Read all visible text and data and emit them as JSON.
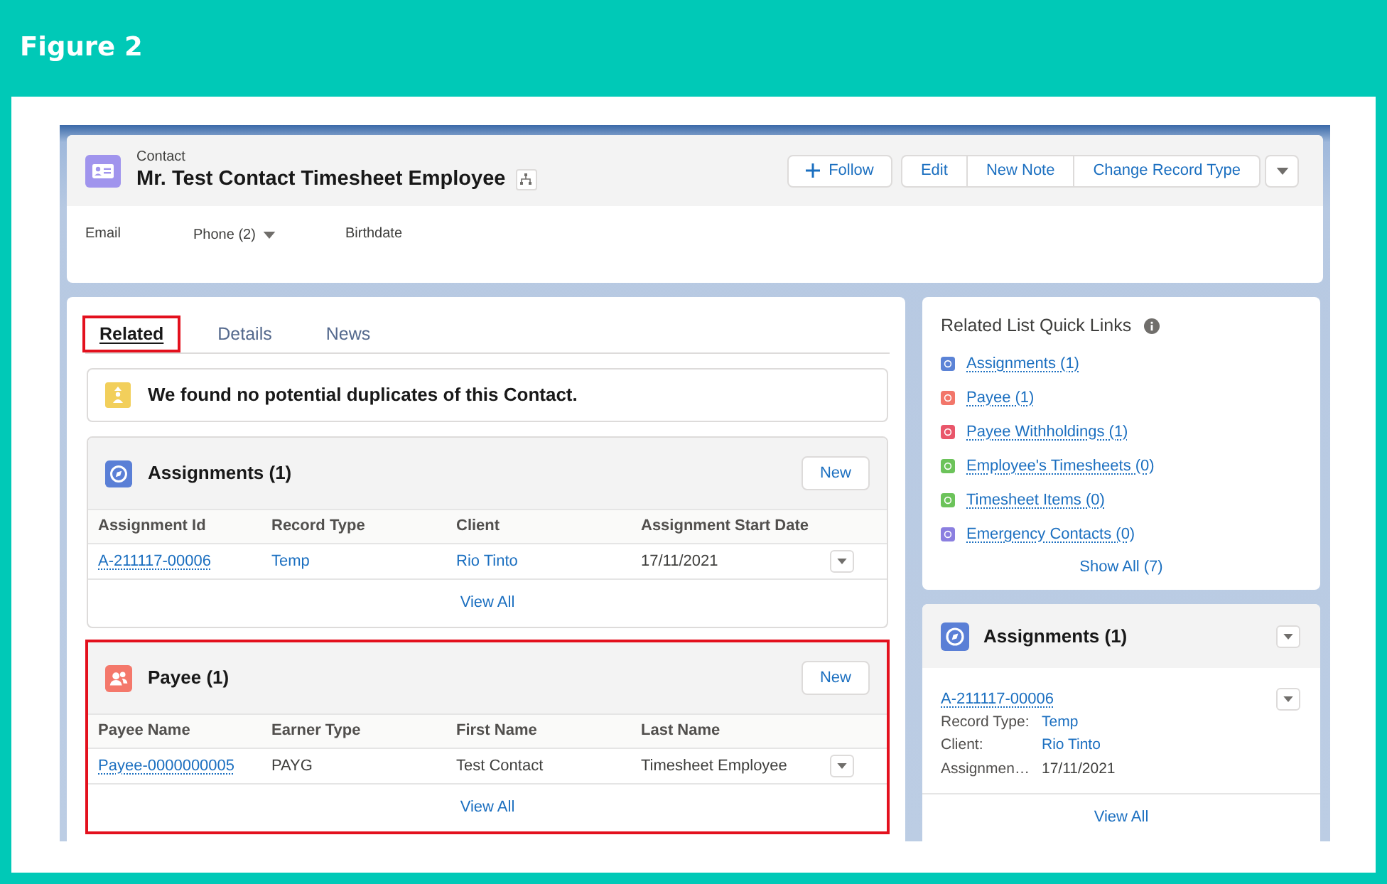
{
  "figure": {
    "title": "Figure 2"
  },
  "record_header": {
    "object_label": "Contact",
    "title": "Mr. Test Contact Timesheet Employee",
    "actions": [
      {
        "label": "Follow",
        "kind": "follow"
      },
      {
        "label": "Edit",
        "kind": "grouped"
      },
      {
        "label": "New Note",
        "kind": "grouped"
      },
      {
        "label": "Change Record Type",
        "kind": "grouped"
      }
    ],
    "fields": [
      {
        "label": "Email",
        "dropdown": false
      },
      {
        "label": "Phone (2)",
        "dropdown": true
      },
      {
        "label": "Birthdate",
        "dropdown": false
      }
    ]
  },
  "tabs": [
    {
      "label": "Related",
      "selected": true,
      "highlighted": true
    },
    {
      "label": "Details",
      "selected": false,
      "highlighted": false
    },
    {
      "label": "News",
      "selected": false,
      "highlighted": false
    }
  ],
  "duplicates_notice": {
    "text": "We found no potential duplicates of this Contact."
  },
  "related_lists": [
    {
      "kind": "assignment",
      "title": "Assignments (1)",
      "highlighted": false,
      "new_button": "New",
      "columns": [
        "Assignment Id",
        "Record Type",
        "Client",
        "Assignment Start Date"
      ],
      "rows": [
        {
          "cells": [
            {
              "text": "A-211117-00006",
              "kind": "record_link"
            },
            {
              "text": "Temp",
              "kind": "link"
            },
            {
              "text": "Rio Tinto",
              "kind": "link"
            },
            {
              "text": "17/11/2021",
              "kind": "text"
            }
          ]
        }
      ],
      "view_all": "View All"
    },
    {
      "kind": "payee",
      "title": "Payee (1)",
      "highlighted": true,
      "new_button": "New",
      "columns": [
        "Payee Name",
        "Earner Type",
        "First Name",
        "Last Name"
      ],
      "rows": [
        {
          "cells": [
            {
              "text": "Payee-0000000005",
              "kind": "record_link"
            },
            {
              "text": "PAYG",
              "kind": "text"
            },
            {
              "text": "Test Contact",
              "kind": "text"
            },
            {
              "text": "Timesheet Employee",
              "kind": "text"
            }
          ]
        }
      ],
      "view_all": "View All"
    }
  ],
  "quick_links": {
    "title": "Related List Quick Links",
    "links": [
      {
        "label": "Assignments (1)",
        "color": "#5b83d6"
      },
      {
        "label": "Payee (1)",
        "color": "#f2766a"
      },
      {
        "label": "Payee Withholdings (1)",
        "color": "#e9566a"
      },
      {
        "label": "Employee's Timesheets (0)",
        "color": "#6cc35a"
      },
      {
        "label": "Timesheet Items (0)",
        "color": "#6cc35a"
      },
      {
        "label": "Emergency Contacts (0)",
        "color": "#8b7fe0"
      }
    ],
    "show_all": "Show All (7)"
  },
  "side_list": {
    "kind": "assignment",
    "title": "Assignments (1)",
    "record": {
      "name": "A-211117-00006",
      "fields": [
        {
          "label": "Record Type:",
          "value": "Temp",
          "kind": "link"
        },
        {
          "label": "Client:",
          "value": "Rio Tinto",
          "kind": "link"
        },
        {
          "label": "Assignmen…",
          "value": "17/11/2021",
          "kind": "text"
        }
      ]
    },
    "view_all": "View All"
  }
}
